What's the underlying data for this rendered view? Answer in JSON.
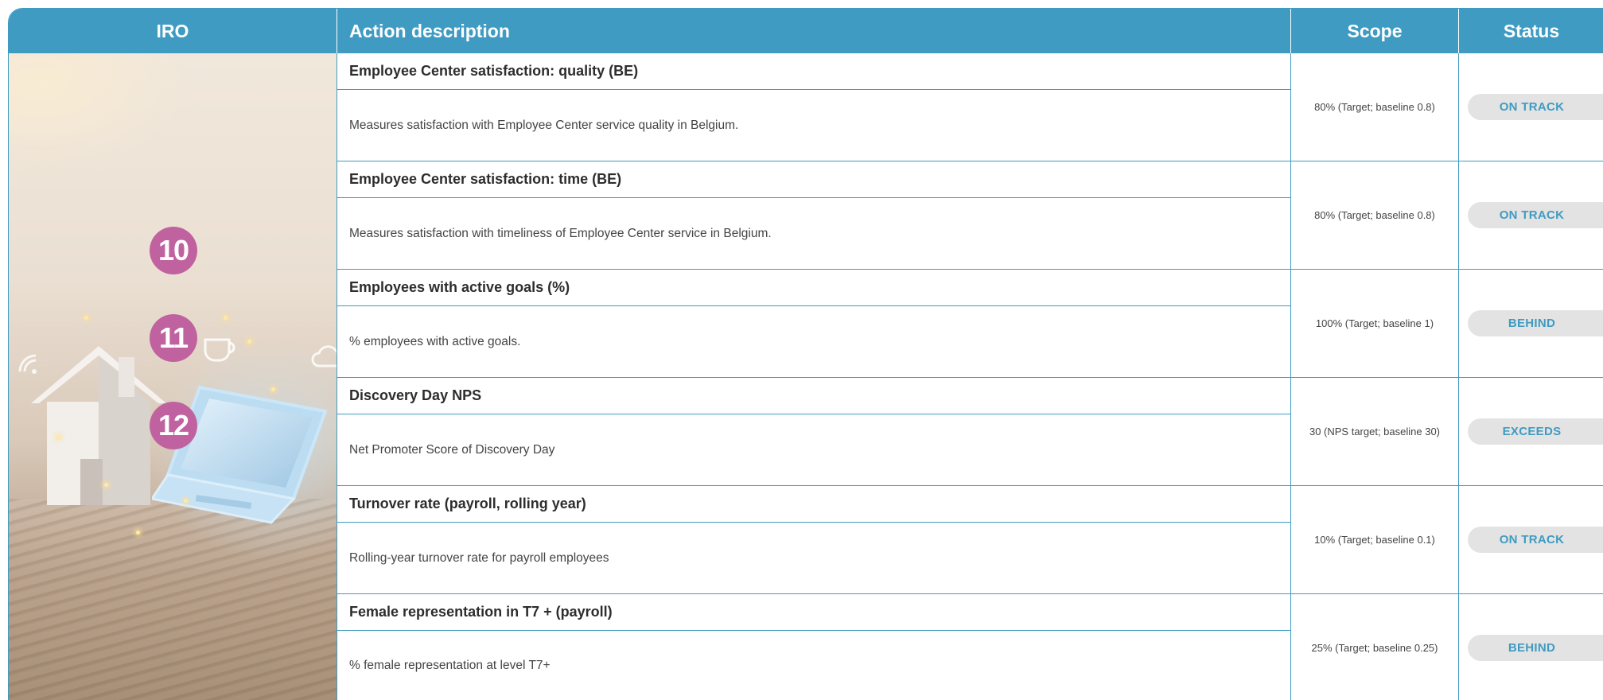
{
  "header": {
    "iro": "IRO",
    "action": "Action description",
    "scope": "Scope",
    "status": "Status"
  },
  "iro_badges": [
    "10",
    "11",
    "12"
  ],
  "rows": [
    {
      "title": "Employee Center satisfaction: quality (BE)",
      "description": "Measures satisfaction with Employee Center service quality in Belgium.",
      "scope": "80% (Target; baseline 0.8)",
      "status": "ON TRACK"
    },
    {
      "title": "Employee Center satisfaction: time (BE)",
      "description": "Measures satisfaction with timeliness of Employee Center service in Belgium.",
      "scope": "80% (Target; baseline 0.8)",
      "status": "ON TRACK"
    },
    {
      "title": "Employees with active goals (%)",
      "description": "% employees with active goals.",
      "scope": "100% (Target; baseline 1)",
      "status": "BEHIND"
    },
    {
      "title": "Discovery Day NPS",
      "description": "Net Promoter Score of Discovery Day",
      "scope": "30 (NPS target; baseline 30)",
      "status": "EXCEEDS"
    },
    {
      "title": "Turnover rate (payroll, rolling year)",
      "description": "Rolling-year turnover rate for payroll employees",
      "scope": "10% (Target; baseline 0.1)",
      "status": "ON TRACK"
    },
    {
      "title": "Female representation in T7 + (payroll)",
      "description": "% female representation at level T7+",
      "scope": "25% (Target; baseline 0.25)",
      "status": "BEHIND"
    }
  ],
  "colors": {
    "accent": "#3f9bc2",
    "badge": "#c0629f",
    "pill": "#e3e3e3"
  },
  "icons": [
    "house-icon",
    "laptop-icon",
    "coffee-cup-icon",
    "wifi-icon",
    "cloud-icon"
  ]
}
